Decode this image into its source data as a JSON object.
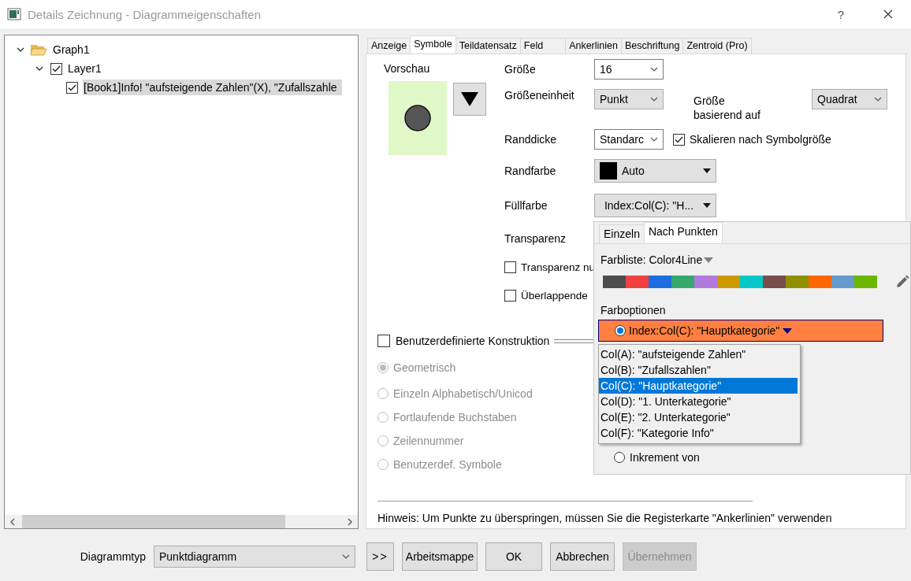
{
  "window": {
    "title": "Details Zeichnung - Diagrammeigenschaften",
    "help": "?"
  },
  "tree": [
    {
      "label": "Graph1",
      "kind": "folder",
      "expanded": true,
      "children": [
        {
          "label": "Layer1",
          "checked": true,
          "expanded": true,
          "children": [
            {
              "label": "[Book1]Info! \"aufsteigende Zahlen\"(X), \"Zufallszahle",
              "checked": true,
              "selected": true
            }
          ]
        }
      ]
    }
  ],
  "tabs": [
    {
      "label": "Anzeige",
      "selected": false
    },
    {
      "label": "Symbole",
      "selected": true
    },
    {
      "label": "Teildatensatz",
      "selected": false
    },
    {
      "label": "Feld",
      "selected": false
    },
    {
      "label": "Ankerlinien",
      "selected": false
    },
    {
      "label": "Beschriftung",
      "selected": false
    },
    {
      "label": "Zentroid (Pro)",
      "selected": false
    }
  ],
  "preview": {
    "label": "Vorschau"
  },
  "symbol_form": {
    "size": {
      "label": "Größe",
      "value": "16"
    },
    "size_unit": {
      "label": "Größeneinheit",
      "value": "Punkt"
    },
    "size_basis": {
      "label": "Größe basierend auf",
      "value": "Quadrat"
    },
    "edge_width": {
      "label": "Randdicke",
      "value": "Standarc"
    },
    "scale_check": {
      "label": "Skalieren nach Symbolgröße",
      "checked": true
    },
    "edge_color": {
      "label": "Randfarbe",
      "value": "Auto",
      "color": "#000000"
    },
    "fill_color": {
      "label": "Füllfarbe",
      "value": "Index:Col(C): \"H..."
    },
    "transparency": {
      "label": "Transparenz"
    },
    "options": [
      {
        "label": "Transparenz nu",
        "checked": false
      },
      {
        "label": "Überlappende",
        "checked": false
      }
    ]
  },
  "construction": {
    "label": "Benutzerdefinierte Konstruktion",
    "checked": false,
    "options": [
      {
        "label": "Geometrisch",
        "selected": true,
        "disabled": true
      },
      {
        "label": "Einzeln Alphabetisch/Unicod",
        "selected": false,
        "disabled": true
      },
      {
        "label": "Fortlaufende Buchstaben",
        "selected": false,
        "disabled": true
      },
      {
        "label": "Zeilennummer",
        "selected": false,
        "disabled": true
      },
      {
        "label": "Benutzerdef. Symbole",
        "selected": false,
        "disabled": true
      }
    ]
  },
  "hint": "Hinweis: Um Punkte zu überspringen, müssen Sie die Registerkarte \"Ankerlinien\" verwenden",
  "color_popup": {
    "tabs": [
      {
        "label": "Einzeln",
        "selected": false
      },
      {
        "label": "Nach Punkten",
        "selected": true
      }
    ],
    "palette_label": "Farbliste: Color4Line",
    "swatches": [
      {
        "color": "#4d4d4d"
      },
      {
        "color": "#f04040"
      },
      {
        "color": "#1c6ee0"
      },
      {
        "color": "#35a96b"
      },
      {
        "color": "#b07ae0"
      },
      {
        "color": "#cc9900"
      },
      {
        "color": "#00c8c8"
      },
      {
        "color": "#7a4c4c"
      },
      {
        "color": "#8f8f00"
      },
      {
        "color": "#ff6600"
      },
      {
        "color": "#6699cc"
      },
      {
        "color": "#6cb600"
      }
    ],
    "options_label": "Farboptionen",
    "option": {
      "value": "Index:Col(C): \"Hauptkategorie\"",
      "selected": true
    },
    "columns": [
      {
        "label": "Col(A): \"aufsteigende Zahlen\"",
        "selected": false
      },
      {
        "label": "Col(B): \"Zufallszahlen\"",
        "selected": false
      },
      {
        "label": "Col(C): \"Hauptkategorie\"",
        "selected": true
      },
      {
        "label": "Col(D): \"1. Unterkategorie\"",
        "selected": false
      },
      {
        "label": "Col(E): \"2. Unterkategorie\"",
        "selected": false
      },
      {
        "label": "Col(F): \"Kategorie Info\"",
        "selected": false
      }
    ],
    "increment": {
      "label": "Inkrement von",
      "selected": false
    }
  },
  "footer": {
    "type_label": "Diagrammtyp",
    "type_value": "Punktdiagramm",
    "buttons": [
      {
        "label": ">>",
        "disabled": false
      },
      {
        "label": "Arbeitsmappe",
        "disabled": false
      },
      {
        "label": "OK",
        "disabled": false
      },
      {
        "label": "Abbrechen",
        "disabled": false
      },
      {
        "label": "Übernehmen",
        "disabled": true
      }
    ]
  }
}
